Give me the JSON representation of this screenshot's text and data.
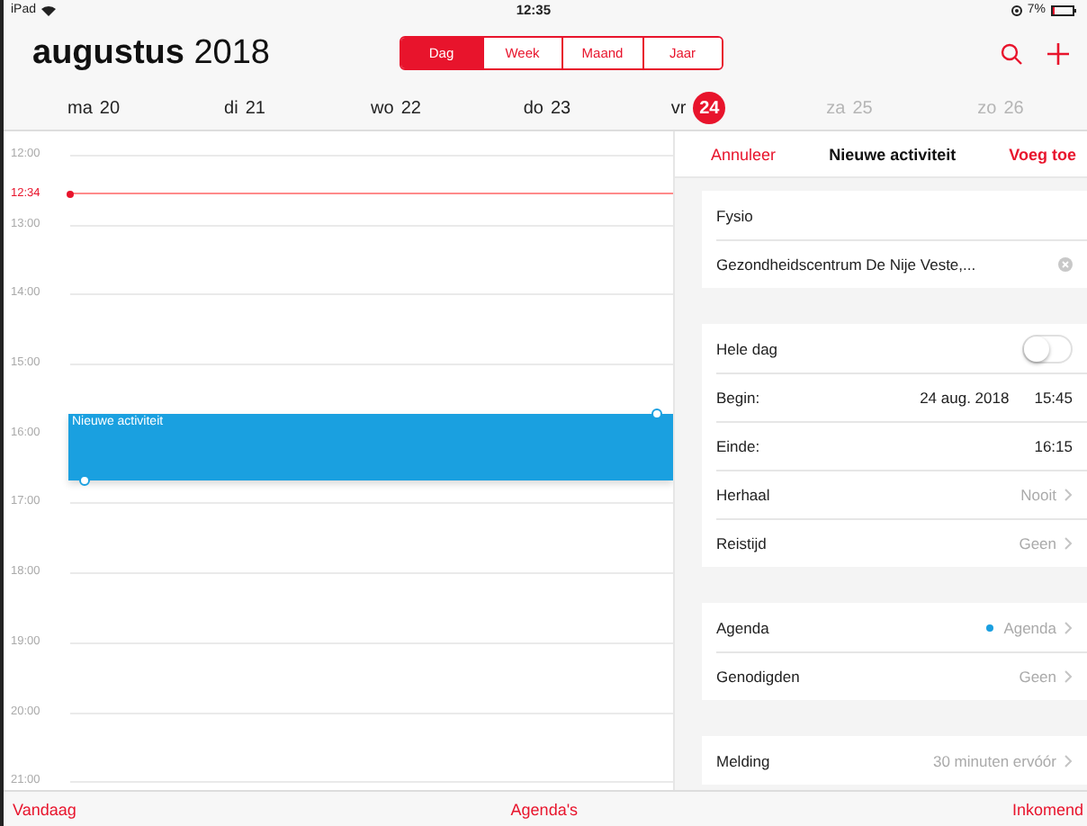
{
  "status_bar": {
    "device": "iPad",
    "time": "12:35",
    "battery": "7%"
  },
  "header": {
    "month": "augustus",
    "year": "2018",
    "views": [
      {
        "label": "Dag",
        "selected": true
      },
      {
        "label": "Week",
        "selected": false
      },
      {
        "label": "Maand",
        "selected": false
      },
      {
        "label": "Jaar",
        "selected": false
      }
    ]
  },
  "days": [
    {
      "weekday": "ma",
      "date": "20",
      "selected": false,
      "weekend": false
    },
    {
      "weekday": "di",
      "date": "21",
      "selected": false,
      "weekend": false
    },
    {
      "weekday": "wo",
      "date": "22",
      "selected": false,
      "weekend": false
    },
    {
      "weekday": "do",
      "date": "23",
      "selected": false,
      "weekend": false
    },
    {
      "weekday": "vr",
      "date": "24",
      "selected": true,
      "weekend": false
    },
    {
      "weekday": "za",
      "date": "25",
      "selected": false,
      "weekend": true
    },
    {
      "weekday": "zo",
      "date": "26",
      "selected": false,
      "weekend": true
    }
  ],
  "timeline": {
    "hours": [
      "12:00",
      "13:00",
      "14:00",
      "15:00",
      "16:00",
      "17:00",
      "18:00",
      "19:00",
      "20:00",
      "21:00"
    ],
    "now": "12:34",
    "event": {
      "title": "Nieuwe activiteit"
    }
  },
  "form": {
    "cancel": "Annuleer",
    "title": "Nieuwe activiteit",
    "add": "Voeg toe",
    "groups": [
      {
        "rows": [
          {
            "kind": "text",
            "label": "Fysio"
          },
          {
            "kind": "clearable",
            "label": "Gezondheidscentrum De Nije Veste,..."
          }
        ]
      },
      {
        "rows": [
          {
            "kind": "toggle",
            "label": "Hele dag",
            "on": false
          },
          {
            "kind": "time",
            "label": "Begin:",
            "date": "24 aug. 2018",
            "value": "15:45"
          },
          {
            "kind": "time",
            "label": "Einde:",
            "value": "16:15"
          },
          {
            "kind": "detail",
            "label": "Herhaal",
            "value": "Nooit"
          },
          {
            "kind": "detail",
            "label": "Reistijd",
            "value": "Geen"
          }
        ]
      },
      {
        "rows": [
          {
            "kind": "detail",
            "label": "Agenda",
            "value": "Agenda",
            "color": "#1a9fe0"
          },
          {
            "kind": "detail",
            "label": "Genodigden",
            "value": "Geen"
          }
        ]
      },
      {
        "rows": [
          {
            "kind": "detail",
            "label": "Melding",
            "value": "30 minuten ervóór"
          }
        ]
      }
    ]
  },
  "toolbar": [
    "Vandaag",
    "Agenda's",
    "Inkomend"
  ]
}
